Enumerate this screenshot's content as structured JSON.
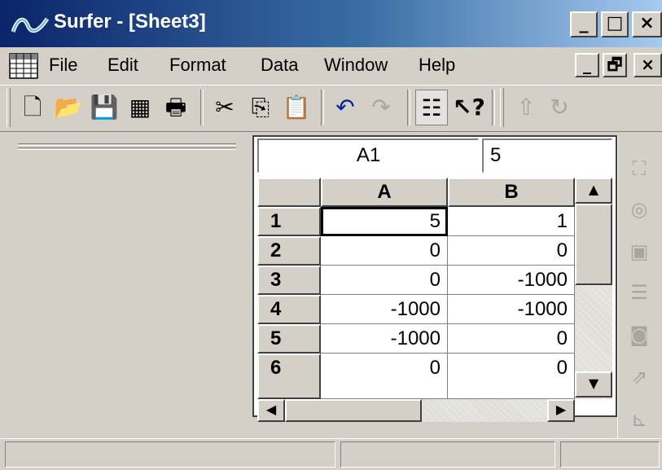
{
  "window": {
    "title": "Surfer - [Sheet3]",
    "caption_buttons": [
      "_",
      "□",
      "×"
    ]
  },
  "menubar": {
    "items": [
      "File",
      "Edit",
      "Format",
      "Data",
      "Window",
      "Help"
    ],
    "mdi_buttons": [
      "_",
      "🗗",
      "×"
    ]
  },
  "toolbar": {
    "icons": [
      "new-icon",
      "open-icon",
      "save-icon",
      "worksheet-icon",
      "print-icon",
      "cut-icon",
      "copy-icon",
      "paste-icon",
      "undo-icon",
      "redo-icon",
      "object-manager-icon",
      "context-help-icon",
      "arrow-up-icon"
    ]
  },
  "sheet": {
    "cell_ref": "A1",
    "cell_value": "5",
    "columns": [
      "A",
      "B"
    ],
    "rows": [
      {
        "num": "1",
        "A": "5",
        "B": "1"
      },
      {
        "num": "2",
        "A": "0",
        "B": "0"
      },
      {
        "num": "3",
        "A": "0",
        "B": "-1000"
      },
      {
        "num": "4",
        "A": "-1000",
        "B": "-1000"
      },
      {
        "num": "5",
        "A": "-1000",
        "B": "0"
      },
      {
        "num": "6",
        "A": "0",
        "B": "0"
      }
    ]
  },
  "right_toolbar": {
    "icons": [
      "map-icon",
      "contour-icon",
      "image-map-icon",
      "post-map-icon",
      "camera-icon",
      "vector-icon",
      "axis-icon"
    ]
  },
  "colors": {
    "title_start": "#0a246a",
    "title_end": "#a6caf0",
    "face": "#d4d0c8"
  }
}
